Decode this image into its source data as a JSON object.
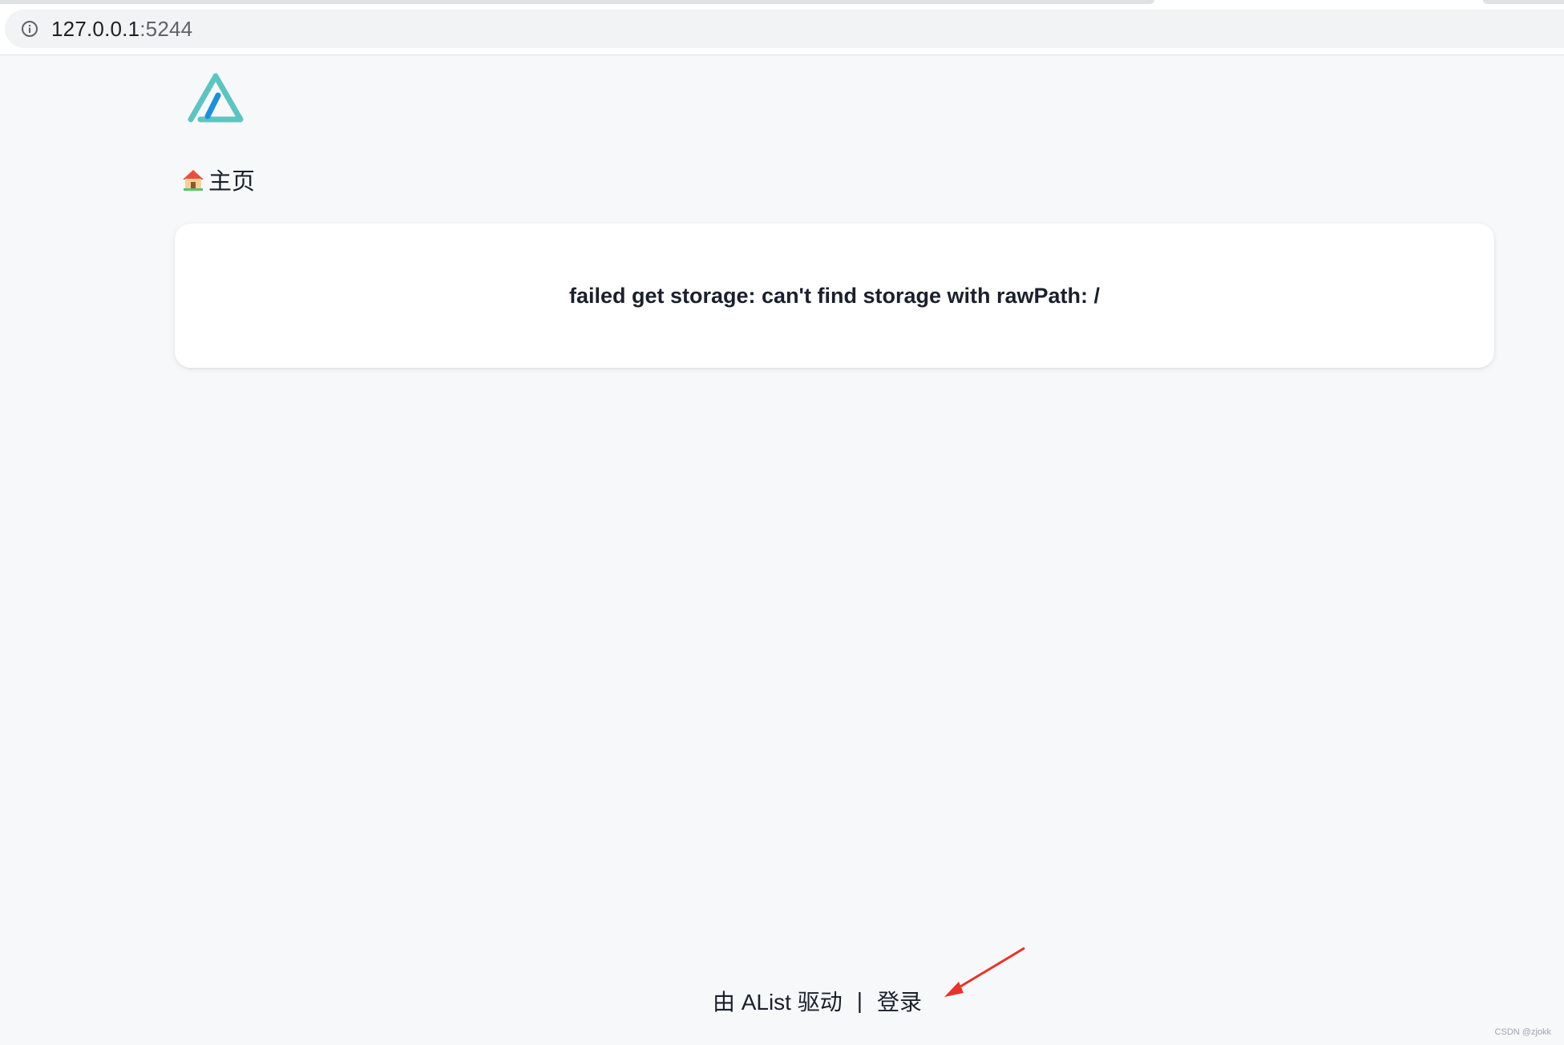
{
  "browser": {
    "url_host": "127.0.0.1",
    "url_port": ":5244"
  },
  "breadcrumb": {
    "home_label": "主页"
  },
  "message": {
    "error_text": "failed get storage: can't find storage with rawPath: /"
  },
  "footer": {
    "powered_by": "由 AList 驱动",
    "separator": "|",
    "login_label": "登录"
  },
  "watermark": {
    "text": "CSDN @zjokk"
  },
  "colors": {
    "page_background": "#f7f8fa",
    "logo_teal": "#5ec4c1",
    "logo_blue": "#1e90d8",
    "arrow_red": "#e8332c"
  }
}
